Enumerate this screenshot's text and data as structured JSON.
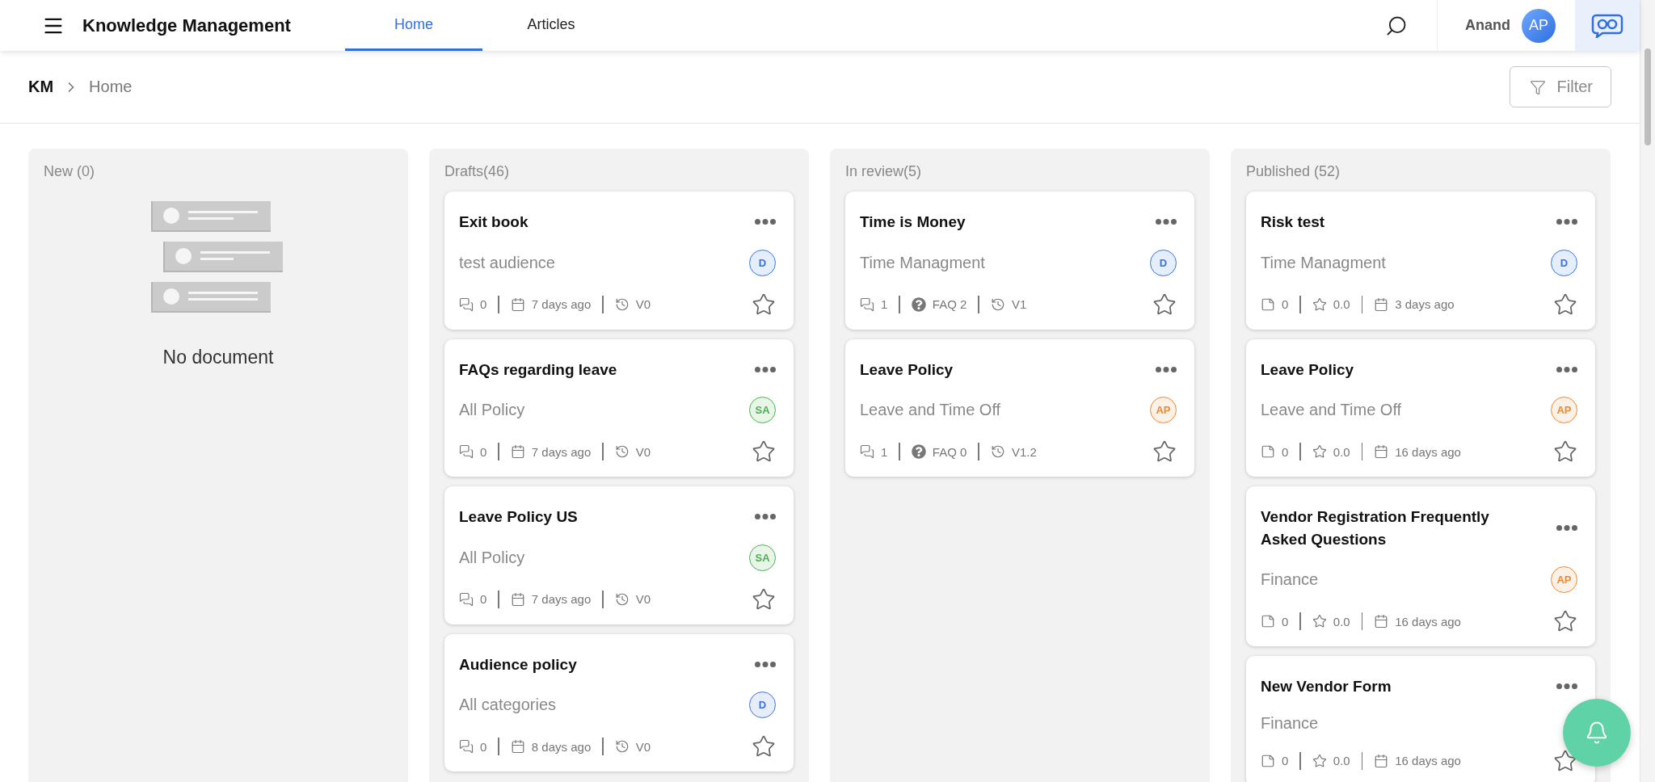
{
  "header": {
    "title": "Knowledge Management",
    "tabs": [
      {
        "label": "Home",
        "selected": true
      },
      {
        "label": "Articles",
        "selected": false
      }
    ],
    "user": {
      "name": "Anand",
      "initials": "AP"
    }
  },
  "breadcrumb": [
    {
      "label": "KM"
    },
    {
      "label": "Home"
    }
  ],
  "filter_button": "Filter",
  "columns": [
    {
      "title": "New (0)",
      "empty_text": "No document"
    },
    {
      "title": "Drafts(46)",
      "cards": [
        {
          "title": "Exit book",
          "category": "test audience",
          "avatar": {
            "initials": "D",
            "color": "#3b73e0"
          },
          "meta": [
            {
              "kind": "comments",
              "text": "0"
            },
            {
              "kind": "date",
              "text": "7 days ago"
            },
            {
              "kind": "version",
              "text": "V0"
            }
          ]
        },
        {
          "title": "FAQs regarding leave",
          "category": "All Policy",
          "avatar": {
            "initials": "SA",
            "color": "#4caf50"
          },
          "meta": [
            {
              "kind": "comments",
              "text": "0"
            },
            {
              "kind": "date",
              "text": "7 days ago"
            },
            {
              "kind": "version",
              "text": "V0"
            }
          ]
        },
        {
          "title": "Leave Policy US",
          "category": "All Policy",
          "avatar": {
            "initials": "SA",
            "color": "#4caf50"
          },
          "meta": [
            {
              "kind": "comments",
              "text": "0"
            },
            {
              "kind": "date",
              "text": "7 days ago"
            },
            {
              "kind": "version",
              "text": "V0"
            }
          ]
        },
        {
          "title": "Audience policy",
          "category": "All categories",
          "avatar": {
            "initials": "D",
            "color": "#3b73e0"
          },
          "meta": [
            {
              "kind": "comments",
              "text": "0"
            },
            {
              "kind": "date",
              "text": "8 days ago"
            },
            {
              "kind": "version",
              "text": "V0"
            }
          ]
        }
      ]
    },
    {
      "title": "In review(5)",
      "cards": [
        {
          "title": "Time is Money",
          "category": "Time Managment",
          "avatar": {
            "initials": "D",
            "color": "#3b73e0"
          },
          "meta": [
            {
              "kind": "comments",
              "text": "1"
            },
            {
              "kind": "faq",
              "text": "FAQ 2"
            },
            {
              "kind": "version",
              "text": "V1"
            }
          ]
        },
        {
          "title": "Leave Policy",
          "category": "Leave and Time Off",
          "avatar": {
            "initials": "AP",
            "color": "#e8893a"
          },
          "meta": [
            {
              "kind": "comments",
              "text": "1"
            },
            {
              "kind": "faq",
              "text": "FAQ 0"
            },
            {
              "kind": "version",
              "text": "V1.2"
            }
          ]
        }
      ]
    },
    {
      "title": "Published (52)",
      "cards": [
        {
          "title": "Risk test",
          "category": "Time Managment",
          "avatar": {
            "initials": "D",
            "color": "#3b73e0"
          },
          "meta": [
            {
              "kind": "notes",
              "text": "0"
            },
            {
              "kind": "rating",
              "text": "0.0"
            },
            {
              "kind": "date",
              "text": "3 days ago"
            }
          ]
        },
        {
          "title": "Leave Policy",
          "category": "Leave and Time Off",
          "avatar": {
            "initials": "AP",
            "color": "#e8893a"
          },
          "meta": [
            {
              "kind": "notes",
              "text": "0"
            },
            {
              "kind": "rating",
              "text": "0.0"
            },
            {
              "kind": "date",
              "text": "16 days ago"
            }
          ]
        },
        {
          "title": "Vendor Registration Frequently Asked Questions",
          "category": "Finance",
          "avatar": {
            "initials": "AP",
            "color": "#e8893a"
          },
          "meta": [
            {
              "kind": "notes",
              "text": "0"
            },
            {
              "kind": "rating",
              "text": "0.0"
            },
            {
              "kind": "date",
              "text": "16 days ago"
            }
          ]
        },
        {
          "title": "New Vendor Form",
          "category": "Finance",
          "meta": [
            {
              "kind": "notes",
              "text": "0"
            },
            {
              "kind": "rating",
              "text": "0.0"
            },
            {
              "kind": "date",
              "text": "16 days ago"
            }
          ]
        }
      ]
    }
  ]
}
